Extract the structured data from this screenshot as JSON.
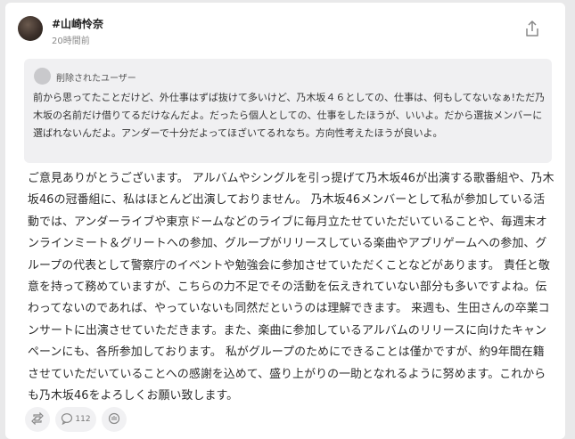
{
  "post": {
    "author": "#山崎怜奈",
    "time": "20時間前"
  },
  "quoted": {
    "author": "削除されたユーザー",
    "text": "前から思ってたことだけど、外仕事はずば抜けて多いけど、乃木坂４６としての、仕事は、何もしてないなぁ!ただ乃木坂の名前だけ借りてるだけなんだよ。だったら個人としての、仕事をしたほうが、いいよ。だから選抜メンバーに選ばれないんだよ。アンダーで十分だよってほざいてるれなち。方向性考えたほうが良いよ。"
  },
  "reply": {
    "text": "ご意見ありがとうございます。 アルバムやシングルを引っ提げて乃木坂46が出演する歌番組や、乃木坂46の冠番組に、私はほとんど出演しておりません。 乃木坂46メンバーとして私が参加している活動では、アンダーライブや東京ドームなどのライブに毎月立たせていただいていることや、毎週末オンラインミート＆グリートへの参加、グループがリリースしている楽曲やアプリゲームへの参加、グループの代表として警察庁のイベントや勉強会に参加させていただくことなどがあります。 責任と敬意を持って務めていますが、こちらの力不足でその活動を伝えきれていない部分も多いですよね。伝わってないのであれば、やっていないも同然だというのは理解できます。 来週も、生田さんの卒業コンサートに出演させていただきます。また、楽曲に参加しているアルバムのリリースに向けたキャンペーンにも、各所参加しております。 私がグループのためにできることは僅かですが、約9年間在籍させていただいていることへの感謝を込めて、盛り上がりの一助となれるように努めます。これからも乃木坂46をよろしくお願い致します。"
  },
  "actions": {
    "comment_count": "112",
    "icons": [
      "repost-icon",
      "comment-icon",
      "reaction-icon"
    ]
  }
}
